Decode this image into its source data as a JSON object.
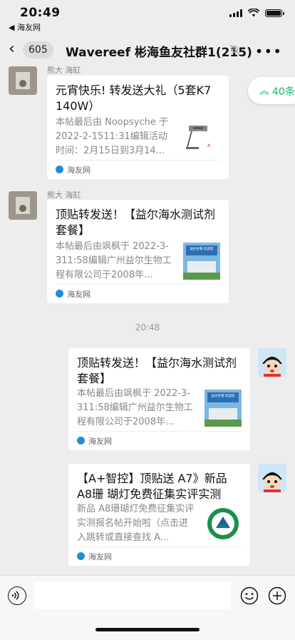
{
  "status_bar": {
    "time": "20:49",
    "back_app": "◀ 海友网"
  },
  "nav": {
    "back_count": "605",
    "title": "Wavereef 彬海鱼友社群1(215)"
  },
  "unread": {
    "count_label": "40条"
  },
  "messages": [
    {
      "sender": "熊大 海缸",
      "title": "元宵快乐! 转发送大礼（5套K7  140W）",
      "desc": "本帖最后由 Noopsyche 于 2022-2-1511:31编辑活动时间：2月15日到3月14...",
      "source": "海友网"
    },
    {
      "sender": "熊大 海缸",
      "title": "顶贴转发送！【益尔海水测试剂套餐】",
      "desc": "本帖最后由飒枫于 2022-3-311:58编辑广州益尔生物工程有限公司于2008年...",
      "thumb_text": "益尔生物 欢迎您",
      "source": "海友网"
    },
    {
      "title": "顶贴转发送！【益尔海水测试剂套餐】",
      "desc": "本帖最后由飒枫于 2022-3-311:58编辑广州益尔生物工程有限公司于2008年...",
      "thumb_text": "益尔生物 欢迎您",
      "source": "海友网"
    },
    {
      "title": "【A+智控】顶贴送 A7》新品A8珊 瑚灯免费征集实评实测",
      "desc": "新品 A8珊瑚灯免费征集实评实测报名帖开始啦（点击进入跳转或直接查找 A...",
      "source": "海友网"
    }
  ],
  "timestamp": "20:48",
  "icons": {
    "back": "chevron-left-icon",
    "mute": "bell-mute-icon",
    "more": "more-icon",
    "voice": "voice-icon",
    "emoji": "emoji-icon",
    "plus": "plus-icon"
  }
}
